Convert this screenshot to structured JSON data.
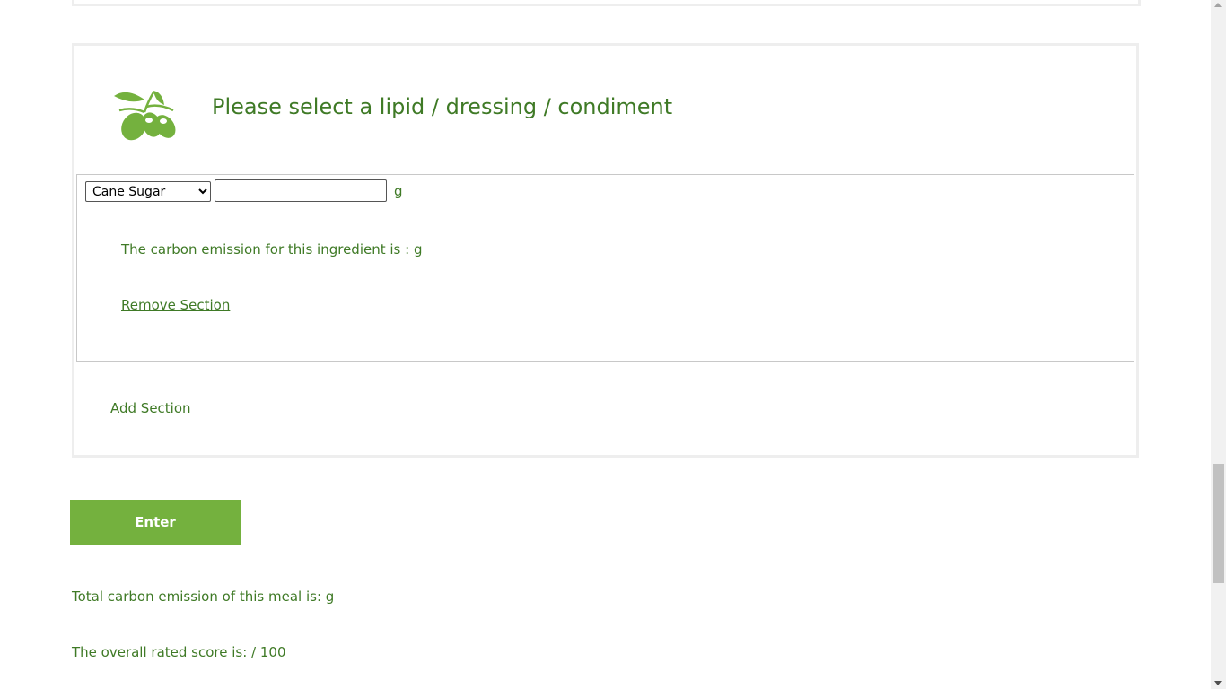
{
  "section": {
    "title": "Please select a lipid / dressing / condiment",
    "icon": "olive-branch-icon",
    "ingredient": {
      "selected": "Cane Sugar",
      "options": [
        "Cane Sugar"
      ],
      "amount_value": "",
      "unit": "g",
      "emission_text": "The carbon emission for this ingredient is : g",
      "remove_label": "Remove Section"
    },
    "add_label": "Add Section"
  },
  "actions": {
    "enter_label": "Enter"
  },
  "results": {
    "total_text": "Total carbon emission of this meal is: g",
    "score_text": "The overall rated score is: / 100"
  },
  "colors": {
    "accent": "#74b13e",
    "text": "#3f7a26",
    "panel_border": "#eeeeee"
  }
}
